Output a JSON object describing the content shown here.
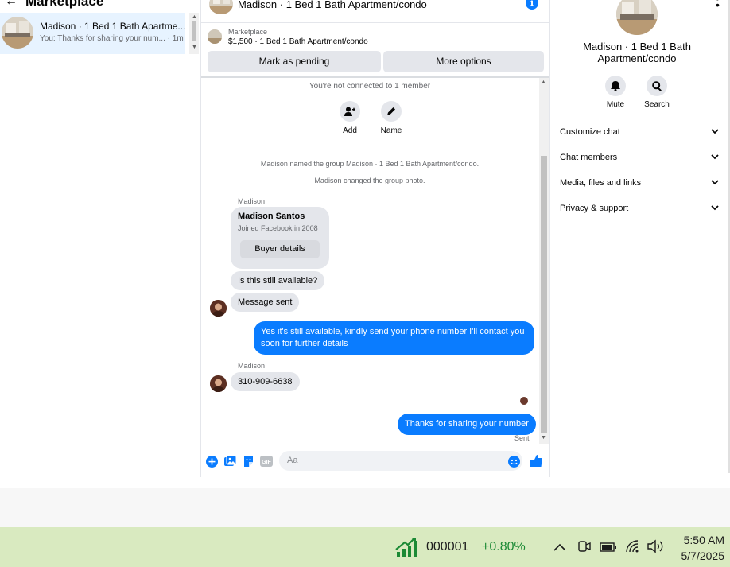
{
  "left_pane": {
    "title": "Marketplace",
    "back_glyph": "←",
    "conversation": {
      "title": "Madison · 1 Bed 1 Bath Apartme...",
      "preview": "You: Thanks for sharing your num... · 1m"
    }
  },
  "chat": {
    "header_title": "Madison · 1 Bed 1 Bath Apartment/condo",
    "info_glyph": "i",
    "listing_source": "Marketplace",
    "listing_price": "$1,500 · 1 Bed 1 Bath Apartment/condo",
    "mark_pending_label": "Mark as pending",
    "more_options_label": "More options",
    "not_connected": "You're not connected to 1 member",
    "add_label": "Add",
    "name_label": "Name",
    "sys_named": "Madison named the group Madison · 1 Bed 1 Bath Apartment/condo.",
    "sys_photo": "Madison changed the group photo.",
    "sender_1": "Madison",
    "card_name": "Madison Santos",
    "card_sub": "Joined Facebook in 2008",
    "card_button": "Buyer details",
    "msg_available": "Is this still available?",
    "msg_sent": "Message sent",
    "msg_reply": "Yes it's still available, kindly send your phone number I'll contact you soon for further details",
    "sender_2": "Madison",
    "msg_phone": "310-909-6638",
    "msg_thanks": "Thanks for sharing your number",
    "sent_status": "Sent",
    "composer_placeholder": "Aa"
  },
  "right_pane": {
    "title": "Madison · 1 Bed 1 Bath Apartment/condo",
    "mute_label": "Mute",
    "search_label": "Search",
    "sections": [
      "Customize chat",
      "Chat members",
      "Media, files and links",
      "Privacy & support"
    ]
  },
  "taskbar": {
    "stock_code": "000001",
    "stock_change": "+0.80%",
    "time": "5:50 AM",
    "date": "5/7/2025"
  },
  "colors": {
    "accent": "#0a7cff",
    "selected_row": "#e7f3ff",
    "taskbar": "#d9eac0",
    "stock_up": "#1c8a35"
  }
}
